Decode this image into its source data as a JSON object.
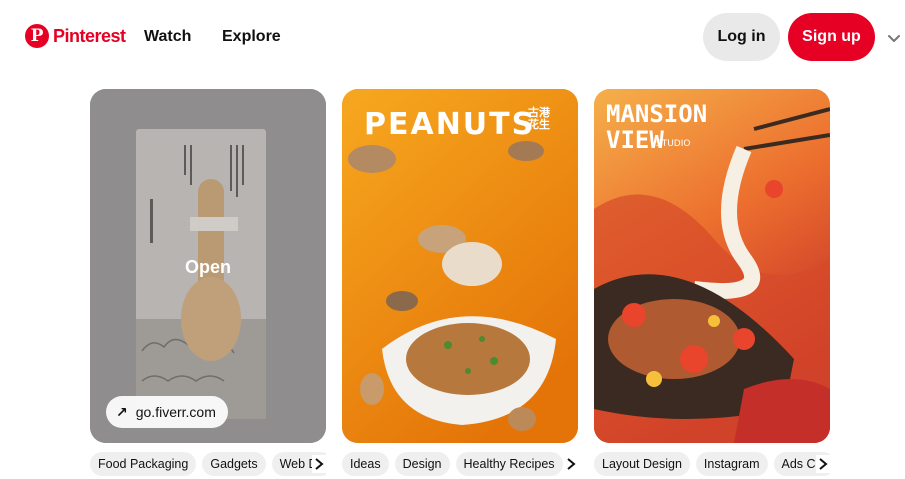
{
  "header": {
    "brand": "Pinterest",
    "nav": [
      "Watch",
      "Explore"
    ],
    "login_label": "Log in",
    "signup_label": "Sign up",
    "brand_color": "#e60023"
  },
  "pins": [
    {
      "hover_label": "Open",
      "source_link": "go.fiverr.com",
      "tags": [
        "Food Packaging",
        "Gadgets",
        "Web De"
      ]
    },
    {
      "title": "PEANUTS",
      "title_cn": "古港花生",
      "tags": [
        "Ideas",
        "Design",
        "Healthy Recipes"
      ]
    },
    {
      "title_line1": "MANSION",
      "title_line2": "VIEW",
      "title_suffix": "STUDIO",
      "tags": [
        "Layout Design",
        "Instagram",
        "Ads Cre"
      ]
    }
  ]
}
